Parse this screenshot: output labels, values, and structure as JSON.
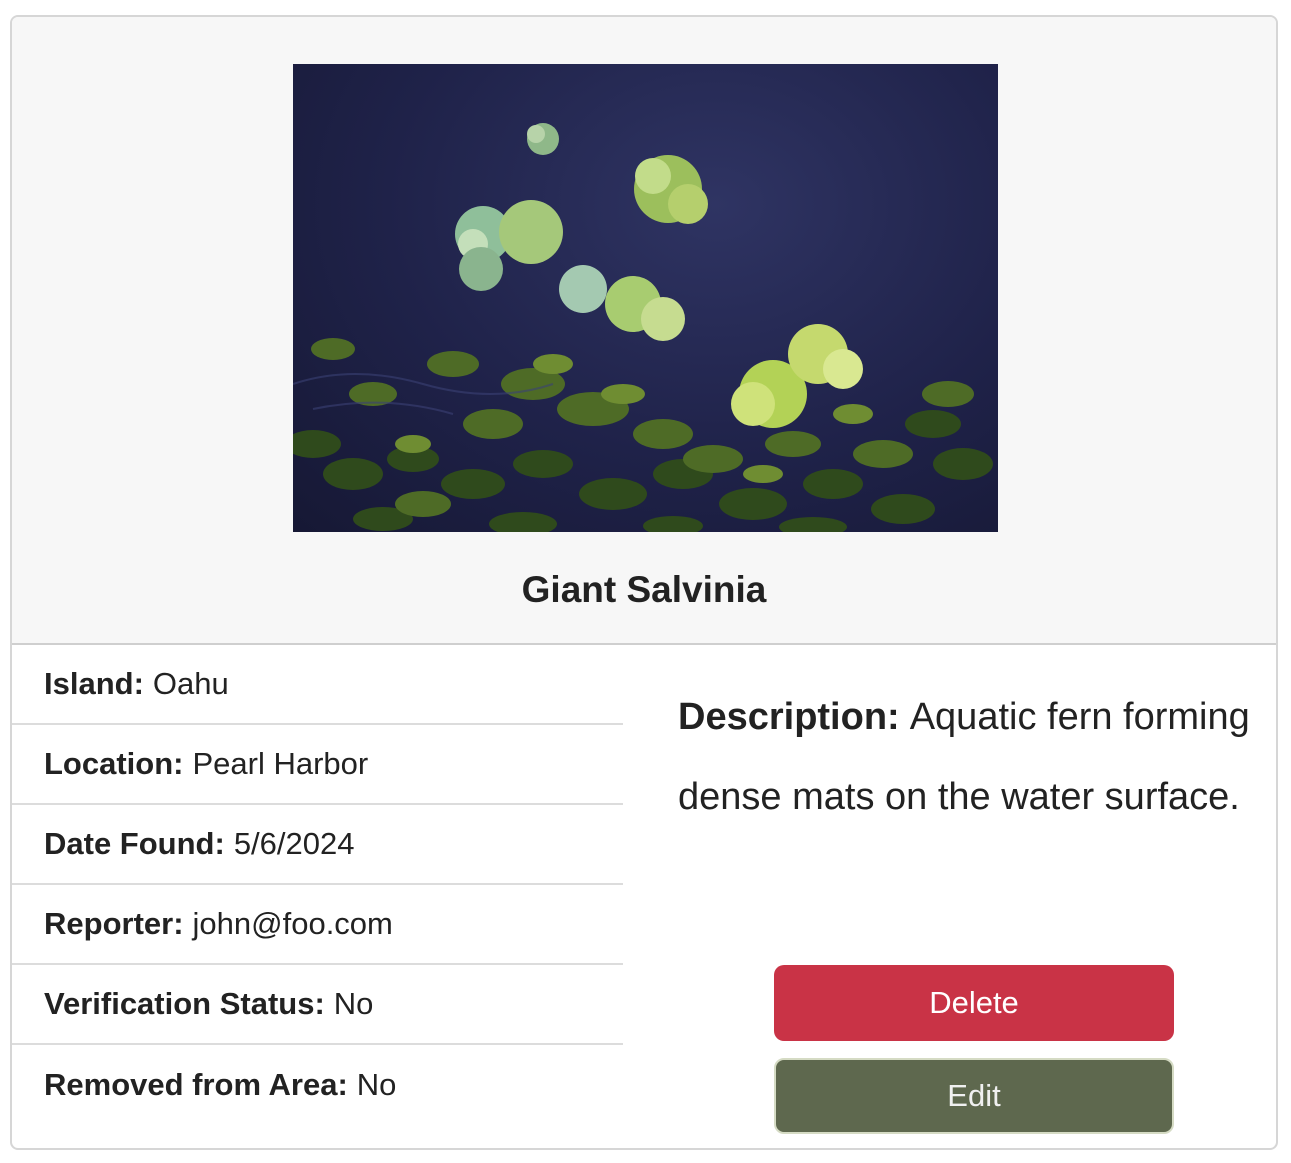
{
  "record": {
    "name": "Giant Salvinia",
    "photo_icon": "aquatic-plant-photo"
  },
  "details": [
    {
      "label": "Island:",
      "value": "Oahu"
    },
    {
      "label": "Location:",
      "value": "Pearl Harbor"
    },
    {
      "label": "Date Found:",
      "value": "5/6/2024"
    },
    {
      "label": "Reporter:",
      "value": "john@foo.com"
    },
    {
      "label": "Verification Status:",
      "value": "No"
    },
    {
      "label": "Removed from Area:",
      "value": "No"
    }
  ],
  "description": {
    "label": "Description:",
    "text": "Aquatic fern forming dense mats on the water surface."
  },
  "actions": {
    "delete_label": "Delete",
    "edit_label": "Edit"
  },
  "colors": {
    "delete": "#c93346",
    "edit": "#5e684e",
    "header_bg": "#f7f7f7"
  }
}
